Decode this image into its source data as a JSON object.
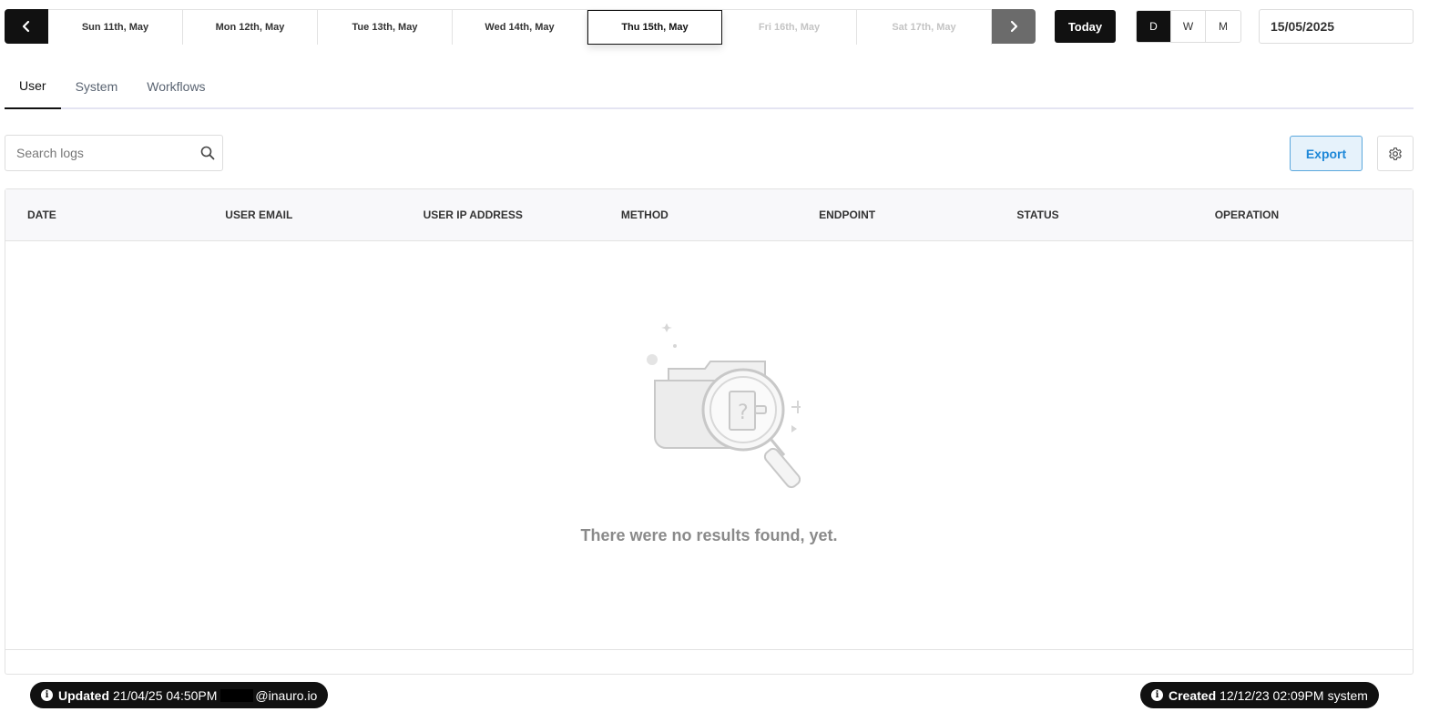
{
  "date_strip": {
    "days": [
      {
        "label": "Sun 11th, May",
        "state": "normal"
      },
      {
        "label": "Mon 12th, May",
        "state": "normal"
      },
      {
        "label": "Tue 13th, May",
        "state": "normal"
      },
      {
        "label": "Wed 14th, May",
        "state": "normal"
      },
      {
        "label": "Thu 15th, May",
        "state": "selected"
      },
      {
        "label": "Fri 16th, May",
        "state": "disabled"
      },
      {
        "label": "Sat 17th, May",
        "state": "disabled"
      }
    ]
  },
  "toolbar": {
    "today_label": "Today",
    "view_options": [
      {
        "label": "D",
        "active": true
      },
      {
        "label": "W",
        "active": false
      },
      {
        "label": "M",
        "active": false
      }
    ],
    "date_value": "15/05/2025"
  },
  "tabs": [
    {
      "label": "User",
      "active": true
    },
    {
      "label": "System",
      "active": false
    },
    {
      "label": "Workflows",
      "active": false
    }
  ],
  "search": {
    "placeholder": "Search logs",
    "value": ""
  },
  "actions": {
    "export_label": "Export"
  },
  "table": {
    "columns": [
      "DATE",
      "USER EMAIL",
      "USER IP ADDRESS",
      "METHOD",
      "ENDPOINT",
      "STATUS",
      "OPERATION"
    ],
    "rows": [],
    "empty_message": "There were no results found, yet."
  },
  "footer": {
    "updated": {
      "label": "Updated",
      "timestamp": "21/04/25 04:50PM",
      "email_suffix": "@inauro.io"
    },
    "created": {
      "label": "Created",
      "timestamp": "12/12/23 02:09PM",
      "by": "system"
    }
  },
  "colors": {
    "accent": "#111111",
    "export_blue": "#1e88d8",
    "tab_underline": "#e4e4f2"
  }
}
